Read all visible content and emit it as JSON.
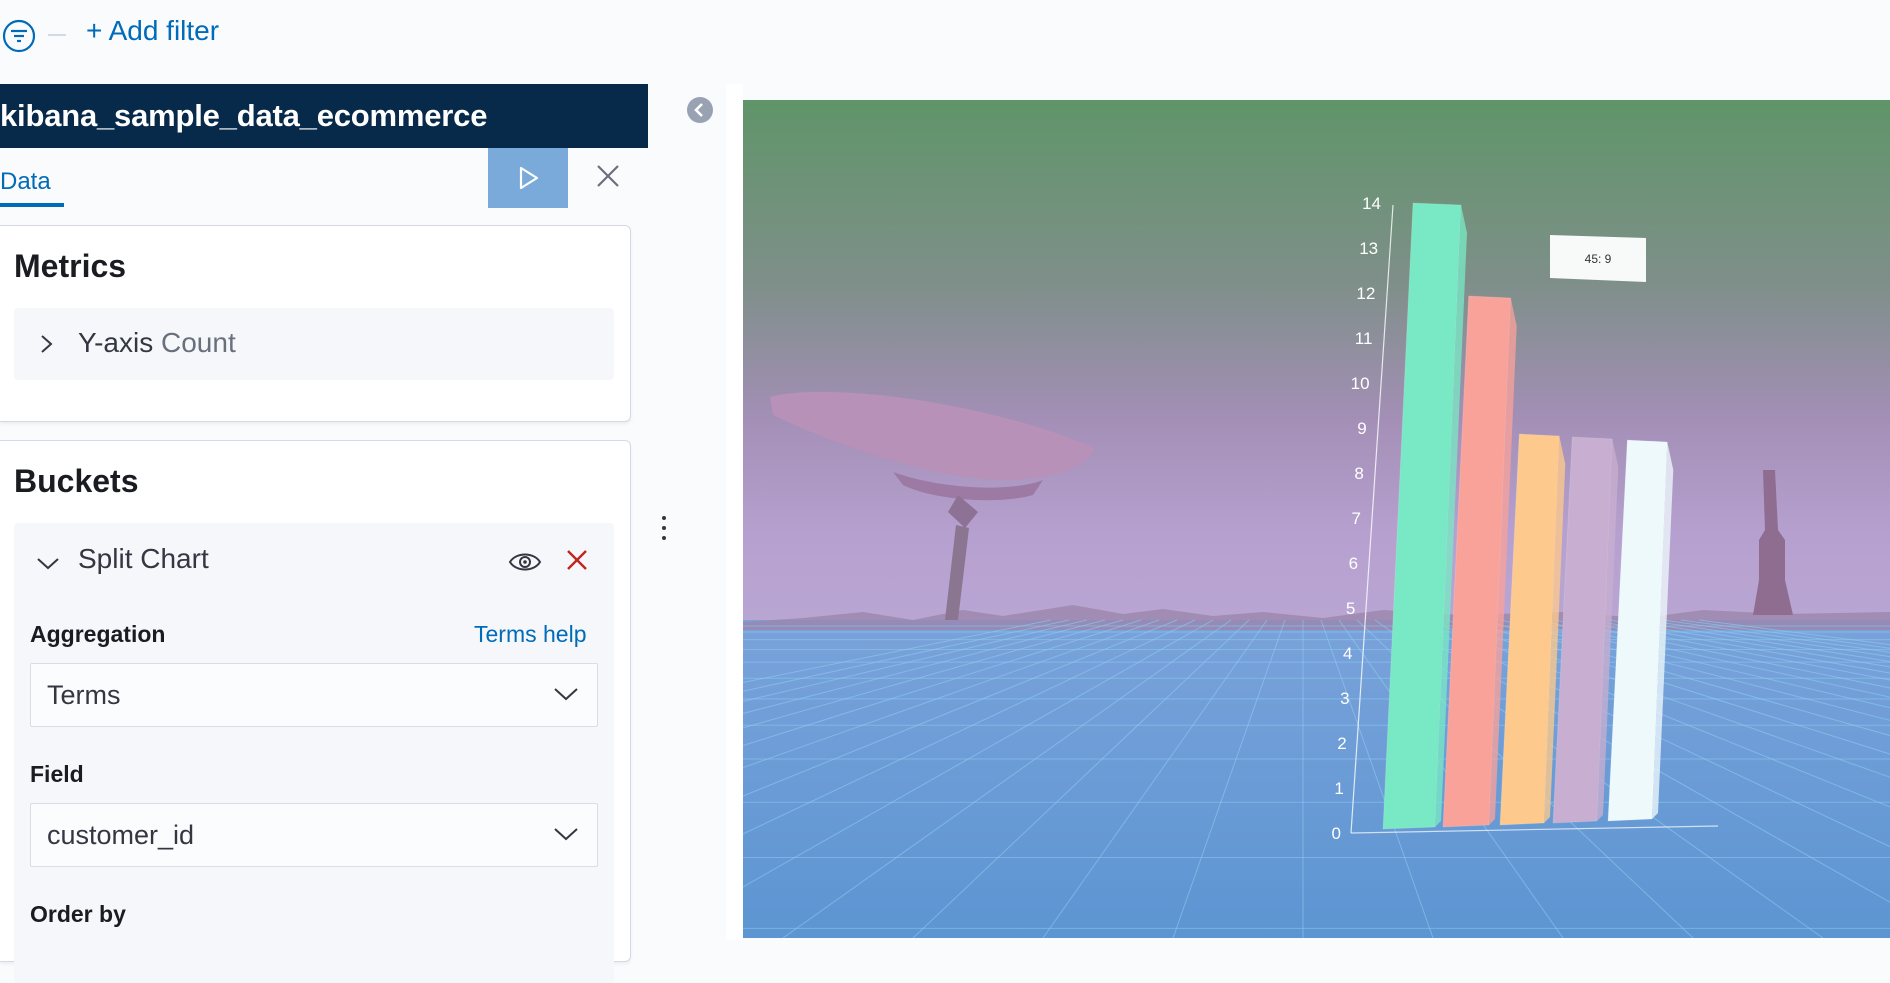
{
  "filter_bar": {
    "add_filter_label": "+ Add filter",
    "icon": "filter-icon"
  },
  "editor": {
    "index_pattern": "kibana_sample_data_ecommerce",
    "tab_data_label": "Data",
    "run_icon": "play-icon",
    "close_icon": "close-icon",
    "metrics": {
      "title": "Metrics",
      "item_prefix": "Y-axis",
      "item_value": "Count"
    },
    "buckets": {
      "title": "Buckets",
      "item_label": "Split Chart",
      "aggregation_label": "Aggregation",
      "aggregation_help": "Terms help",
      "aggregation_value": "Terms",
      "field_label": "Field",
      "field_value": "customer_id",
      "order_by_label": "Order by"
    }
  },
  "scene": {
    "type": "3d-bar-chart",
    "tooltip": "45: 9",
    "y_ticks": [
      "0",
      "1",
      "2",
      "3",
      "4",
      "5",
      "6",
      "7",
      "8",
      "9",
      "10",
      "11",
      "12",
      "13",
      "14"
    ],
    "colors": {
      "sky_top": "#5f9569",
      "sky_mid": "#a38fb6",
      "ground": "#6a9fd6",
      "grid": "#8fd0f2"
    }
  },
  "chart_data": {
    "type": "bar",
    "categories": [
      "",
      "",
      "",
      "",
      ""
    ],
    "values": [
      14,
      12,
      9,
      9,
      9
    ],
    "colors": [
      "#79e8c4",
      "#f9a29a",
      "#fdc98c",
      "#c8aed0",
      "#eef9fb"
    ],
    "ylim": [
      0,
      14
    ],
    "xlabel": "",
    "ylabel": "",
    "title": ""
  }
}
